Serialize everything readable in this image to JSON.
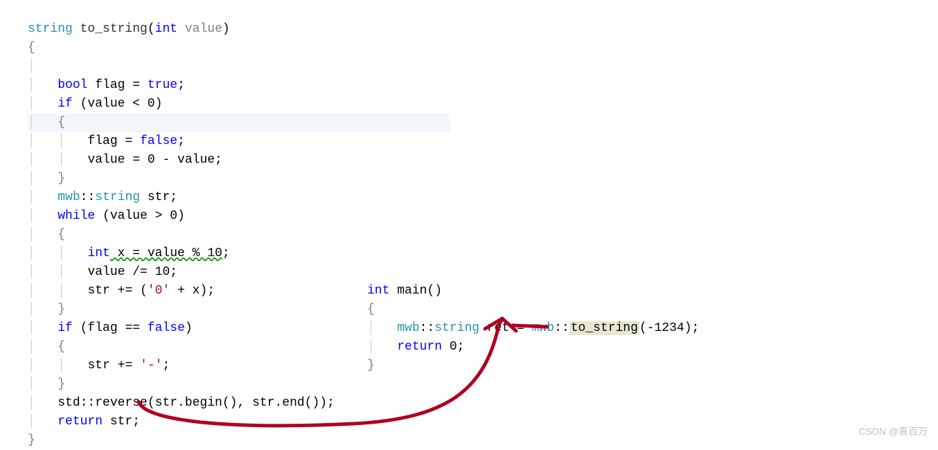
{
  "left": {
    "l1_type": "string",
    "l1_func": "to_string",
    "l1_paramtype": "int",
    "l1_paramname": "value",
    "l2": "{",
    "l4_type": "bool",
    "l4_var": "flag",
    "l4_eq": " = ",
    "l4_val": "true",
    "l5_if": "if",
    "l5_cond": " (value < 0)",
    "l6": "{",
    "l7_var": "flag",
    "l7_eq": " = ",
    "l7_val": "false",
    "l7_semi": ";",
    "l8": "value = 0 - value;",
    "l9": "}",
    "l10_ns": "mwb",
    "l10_sep": "::",
    "l10_type": "string",
    "l10_var": " str;",
    "l11_while": "while",
    "l11_cond": " (value > 0)",
    "l12": "{",
    "l13_type": "int",
    "l13_rest": " x = value % 10",
    "l13_semi": ";",
    "l14": "value /= 10;",
    "l15_a": "str += (",
    "l15_char": "'0'",
    "l15_b": " + x);",
    "l16": "}",
    "l17_if": "if",
    "l17_cond": " (flag == ",
    "l17_val": "false",
    "l17_close": ")",
    "l18": "{",
    "l19_a": "str += ",
    "l19_char": "'-'",
    "l19_semi": ";",
    "l20": "}",
    "l21": "std::reverse(str.begin(), str.end());",
    "l22_ret": "return",
    "l22_val": " str;",
    "l23": "}"
  },
  "right": {
    "r1_type": "int",
    "r1_func": " main()",
    "r2": "{",
    "r3_ns1": "mwb",
    "r3_sep1": "::",
    "r3_type": "string",
    "r3_var": " ret = ",
    "r3_ns2": "mwb",
    "r3_sep2": "::",
    "r3_call": "to_string",
    "r3_arg": "(-1234);",
    "r4_ret": "return",
    "r4_val": " 0;",
    "r5": "}"
  },
  "watermark": "CSDN @袁百万"
}
